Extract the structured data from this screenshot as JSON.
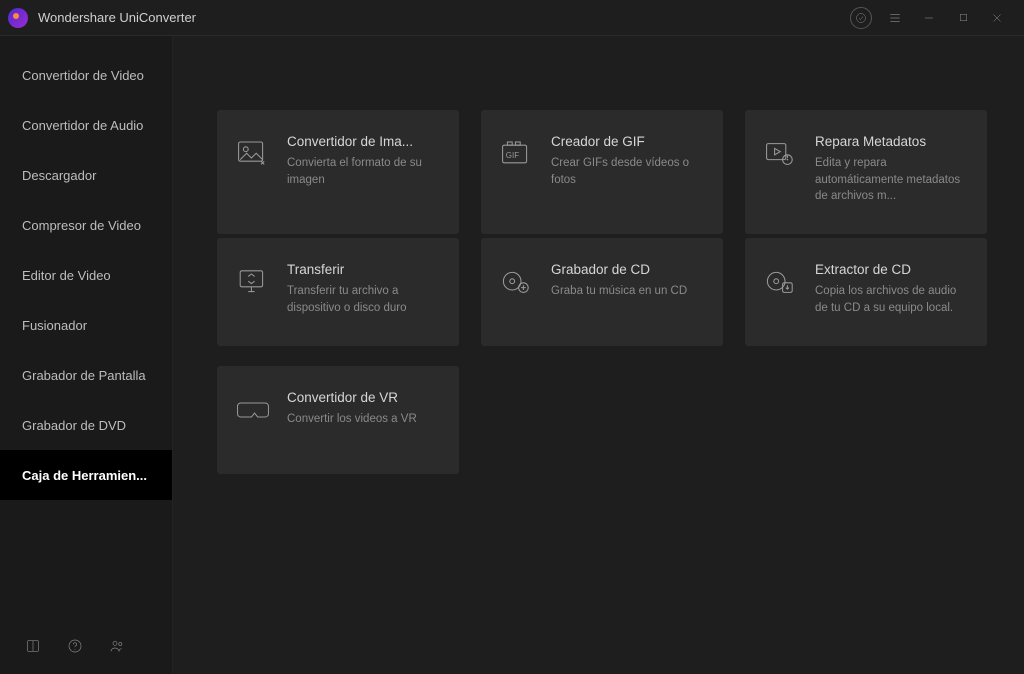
{
  "app": {
    "title": "Wondershare UniConverter"
  },
  "sidebar": {
    "items": [
      {
        "label": "Convertidor de Video"
      },
      {
        "label": "Convertidor de Audio"
      },
      {
        "label": "Descargador"
      },
      {
        "label": "Compresor de Video"
      },
      {
        "label": "Editor de Video"
      },
      {
        "label": "Fusionador"
      },
      {
        "label": "Grabador de Pantalla"
      },
      {
        "label": "Grabador de DVD"
      },
      {
        "label": "Caja de Herramien..."
      }
    ],
    "active_index": 8
  },
  "tools": [
    {
      "id": "image-converter",
      "title": "Convertidor de Ima...",
      "desc": "Convierta el formato de su imagen"
    },
    {
      "id": "gif-maker",
      "title": "Creador de GIF",
      "desc": "Crear GIFs desde vídeos o fotos"
    },
    {
      "id": "fix-metadata",
      "title": "Repara Metadatos",
      "desc": "Edita y repara automáticamente metadatos de archivos m..."
    },
    {
      "id": "transfer",
      "title": "Transferir",
      "desc": "Transferir tu archivo a dispositivo o disco duro"
    },
    {
      "id": "cd-burner",
      "title": "Grabador de CD",
      "desc": "Graba tu música en un CD"
    },
    {
      "id": "cd-ripper",
      "title": "Extractor de CD",
      "desc": "Copia los archivos de audio de tu CD a su equipo local."
    },
    {
      "id": "vr-converter",
      "title": "Convertidor de VR",
      "desc": "Convertir los videos a VR"
    }
  ]
}
